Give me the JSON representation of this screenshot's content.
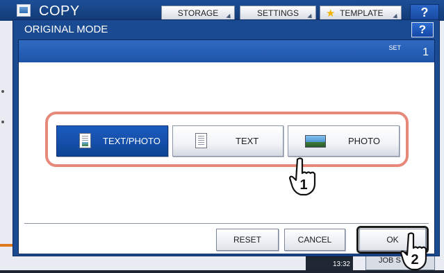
{
  "background": {
    "title": "COPY",
    "tabs": [
      {
        "label": "STORAGE"
      },
      {
        "label": "SETTINGS"
      },
      {
        "label": "TEMPLATE"
      }
    ],
    "help_label": "?",
    "clock": "13:32",
    "job_status_label": "JOB S"
  },
  "dialog": {
    "title": "ORIGINAL MODE",
    "help_label": "?",
    "set_label": "SET",
    "set_count": "1",
    "modes": [
      {
        "label": "TEXT/PHOTO",
        "icon": "text-photo-icon",
        "selected": true
      },
      {
        "label": "TEXT",
        "icon": "text-document-icon",
        "selected": false
      },
      {
        "label": "PHOTO",
        "icon": "photo-icon",
        "selected": false
      }
    ],
    "footer": {
      "reset_label": "RESET",
      "cancel_label": "CANCEL",
      "ok_label": "OK"
    }
  },
  "callouts": [
    {
      "number": "1",
      "icon": "pointing-hand-icon"
    },
    {
      "number": "2",
      "icon": "pointing-hand-icon"
    }
  ],
  "colors": {
    "header_blue": "#1a4b92",
    "selected_blue": "#1b5cbf",
    "highlight_outline": "#e6887a"
  }
}
